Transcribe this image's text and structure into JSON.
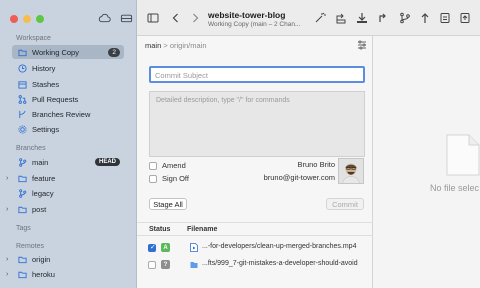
{
  "colors": {
    "accent": "#2f6fd4",
    "sidebar_bg": "#c9d3df",
    "selected_bg": "#a9b6c5",
    "added": "#5bb85b",
    "untracked": "#8f8f8f"
  },
  "sidebar": {
    "workspace_label": "Workspace",
    "items": [
      {
        "label": "Working Copy",
        "icon": "folder-icon",
        "badge": "2"
      },
      {
        "label": "History",
        "icon": "clock-icon"
      },
      {
        "label": "Stashes",
        "icon": "box-icon"
      },
      {
        "label": "Pull Requests",
        "icon": "pull-request-icon"
      },
      {
        "label": "Branches Review",
        "icon": "branches-review-icon"
      },
      {
        "label": "Settings",
        "icon": "gear-icon"
      }
    ],
    "branches_label": "Branches",
    "branches": [
      {
        "label": "main",
        "badge": "HEAD"
      },
      {
        "label": "feature"
      },
      {
        "label": "legacy"
      },
      {
        "label": "post"
      }
    ],
    "tags_label": "Tags",
    "remotes_label": "Remotes",
    "remotes": [
      {
        "label": "origin"
      },
      {
        "label": "heroku"
      }
    ]
  },
  "toolbar": {
    "title": "website-tower-blog",
    "subtitle": "Working Copy (main – 2 Chan..."
  },
  "commit": {
    "breadcrumb_branch": "main",
    "breadcrumb_sep": ">",
    "breadcrumb_remote": "origin/main",
    "subject_placeholder": "Commit Subject",
    "description_placeholder": "Detailed description, type \"/\" for commands",
    "amend_label": "Amend",
    "signoff_label": "Sign Off",
    "author_name": "Bruno Brito",
    "author_email": "bruno@git-tower.com",
    "stage_all_label": "Stage All",
    "commit_label": "Commit"
  },
  "files": {
    "headers": {
      "status": "Status",
      "filename": "Filename"
    },
    "rows": [
      {
        "checked": true,
        "status": "A",
        "name": "...-for-developers/clean-up-merged-branches.mp4"
      },
      {
        "checked": false,
        "status": "?",
        "name": "...fts/999_7-git-mistakes-a-developer-should-avoid"
      }
    ]
  },
  "preview": {
    "empty_text": "No file selec"
  }
}
